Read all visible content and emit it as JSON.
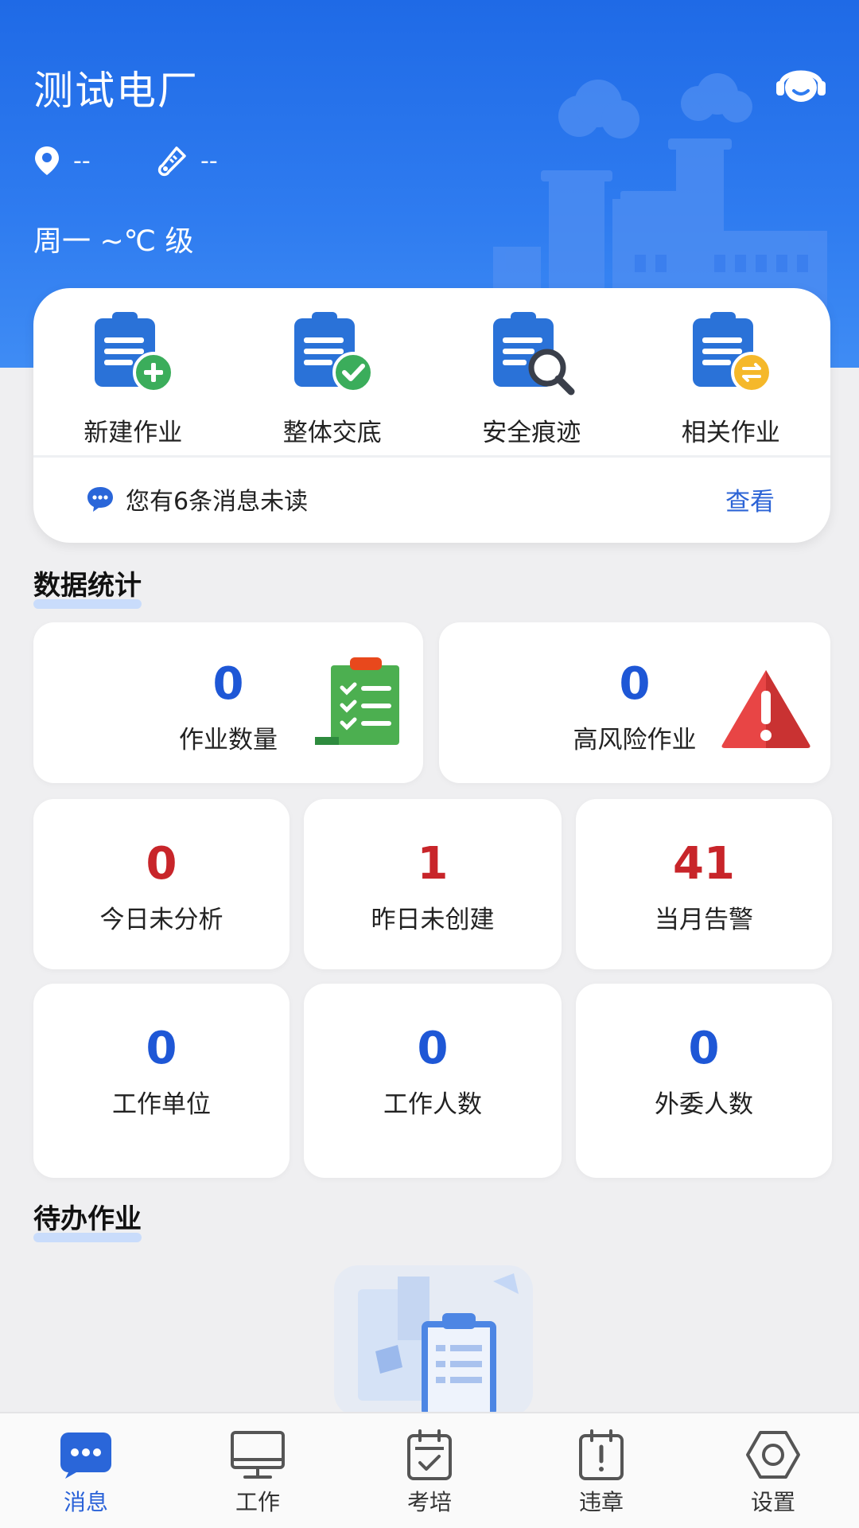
{
  "header": {
    "title": "测试电厂",
    "location": "--",
    "temperature": "--",
    "weather_line": "周一 ~℃ 级"
  },
  "quick_actions": [
    {
      "label": "新建作业",
      "icon": "clipboard-add-icon"
    },
    {
      "label": "整体交底",
      "icon": "clipboard-check-icon"
    },
    {
      "label": "安全痕迹",
      "icon": "clipboard-search-icon"
    },
    {
      "label": "相关作业",
      "icon": "clipboard-exchange-icon"
    }
  ],
  "message_bar": {
    "text": "您有6条消息未读",
    "action": "查看",
    "icon": "chat-bubble-icon"
  },
  "stats_section": {
    "title": "数据统计",
    "top": [
      {
        "value": "0",
        "label": "作业数量",
        "icon": "checklist-icon"
      },
      {
        "value": "0",
        "label": "高风险作业",
        "icon": "warning-triangle-icon"
      }
    ],
    "middle": [
      {
        "value": "0",
        "label": "今日未分析"
      },
      {
        "value": "1",
        "label": "昨日未创建"
      },
      {
        "value": "41",
        "label": "当月告警"
      }
    ],
    "bottom": [
      {
        "value": "0",
        "label": "工作单位"
      },
      {
        "value": "0",
        "label": "工作人数"
      },
      {
        "value": "0",
        "label": "外委人数"
      }
    ]
  },
  "todo_section": {
    "title": "待办作业"
  },
  "bottom_nav": [
    {
      "label": "消息",
      "icon": "message-icon",
      "active": true
    },
    {
      "label": "工作",
      "icon": "monitor-icon",
      "active": false
    },
    {
      "label": "考培",
      "icon": "calendar-check-icon",
      "active": false
    },
    {
      "label": "违章",
      "icon": "calendar-alert-icon",
      "active": false
    },
    {
      "label": "设置",
      "icon": "settings-hex-icon",
      "active": false
    }
  ],
  "colors": {
    "header_blue": "#1f6ae6",
    "value_blue": "#1e57d6",
    "value_red": "#c8252a",
    "link_blue": "#2c64d6"
  }
}
